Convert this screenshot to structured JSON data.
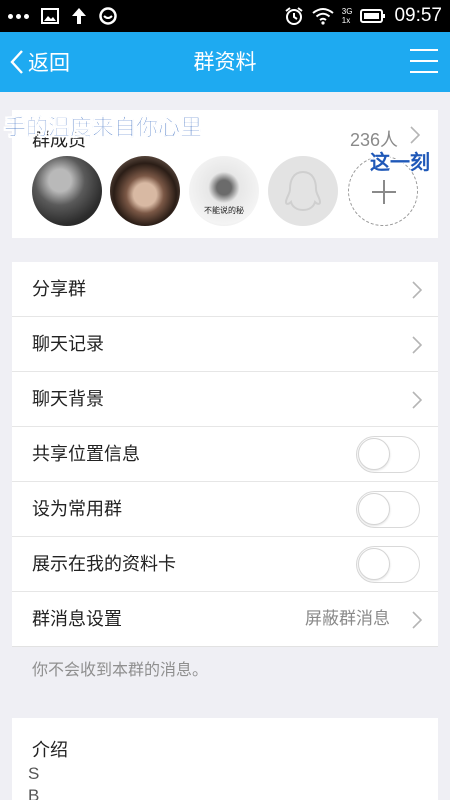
{
  "status_bar": {
    "time": "09:57",
    "network_top": "3G",
    "network_bottom": "1x",
    "icons": [
      "more-dots-icon",
      "image-icon",
      "upload-arrow-icon",
      "app-icon",
      "alarm-icon",
      "wifi-icon",
      "signal-icon",
      "battery-icon"
    ]
  },
  "nav": {
    "back_label": "返回",
    "title": "群资料",
    "menu_icon": "menu-icon"
  },
  "members": {
    "label": "群成员",
    "count": "236人",
    "avatar_caption": "不能说的秘"
  },
  "overlay": {
    "caption1": "手的温度来自你心里",
    "caption2": "这一刻"
  },
  "settings": {
    "share_group": "分享群",
    "chat_history": "聊天记录",
    "chat_background": "聊天背景",
    "share_location": "共享位置信息",
    "set_common_group": "设为常用群",
    "show_on_profile": "展示在我的资料卡",
    "message_settings": "群消息设置",
    "message_settings_value": "屏蔽群消息"
  },
  "toggles": {
    "share_location": false,
    "set_common_group": false,
    "show_on_profile": false
  },
  "footer_note": "你不会收到本群的消息。",
  "intro": {
    "title": "介绍",
    "line1": "S",
    "line2": "B"
  },
  "colors": {
    "nav_bg": "#1eaaf1",
    "page_bg": "#efeff4",
    "overlay_text": "#1f58b8"
  }
}
